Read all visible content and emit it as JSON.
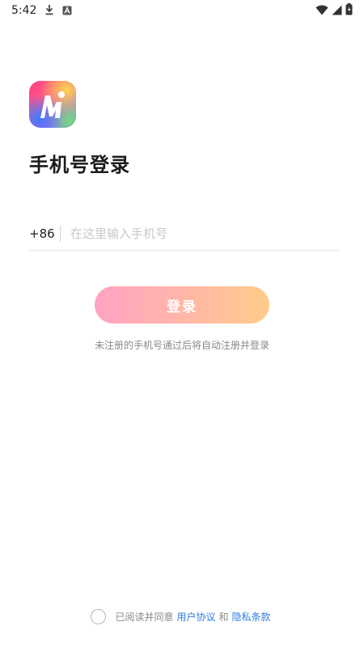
{
  "status_bar": {
    "time": "5:42",
    "icons": [
      "download-icon",
      "font-a-icon",
      "wifi-icon",
      "signal-icon",
      "battery-icon"
    ]
  },
  "login": {
    "title": "手机号登录",
    "country_code": "+86",
    "phone_value": "",
    "phone_placeholder": "在这里输入手机号",
    "login_label": "登录",
    "hint": "未注册的手机号通过后将自动注册并登录"
  },
  "agreement": {
    "prefix": "已阅读并同意",
    "user_agreement": "用户协议",
    "and": "和",
    "privacy": "隐私条款",
    "checked": false
  },
  "colors": {
    "link": "#2f7be0",
    "button_gradient_start": "#ffa3c4",
    "button_gradient_end": "#ffcc8a"
  }
}
